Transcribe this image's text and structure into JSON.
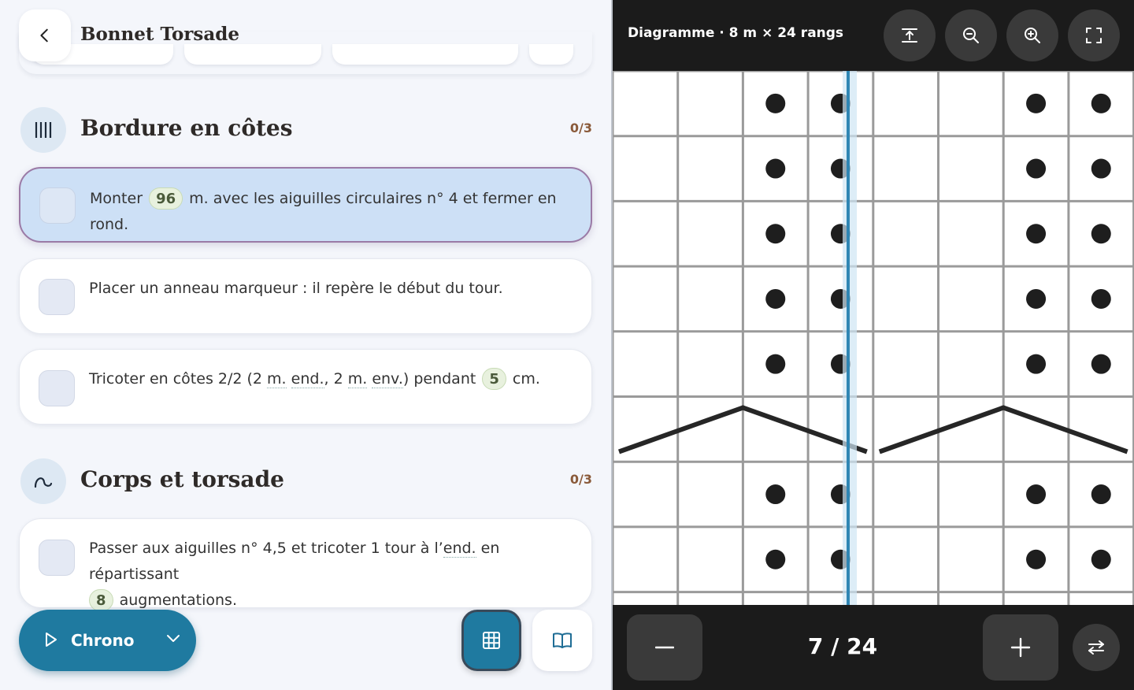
{
  "app": {
    "title": "Bonnet Torsade"
  },
  "sections": [
    {
      "title": "Bordure en côtes",
      "count": "0/3",
      "steps": [
        {
          "parts": [
            "Monter ",
            "96",
            " m. avec les aiguilles circulaires n° 4 et fermer en rond."
          ]
        },
        {
          "parts": [
            "Placer un anneau marqueur : il repère le début du tour."
          ]
        },
        {
          "parts": [
            "Tricoter en côtes 2/2 (2 ",
            "m.",
            " ",
            "end.",
            ", 2 ",
            "m.",
            " ",
            "env.",
            ") pendant ",
            "5",
            " cm."
          ]
        }
      ]
    },
    {
      "title": "Corps et torsade",
      "count": "0/3",
      "steps": [
        {
          "line1": [
            "Passer aux aiguilles n° 4,5 et tricoter 1 tour à l’",
            "end.",
            " en répartissant"
          ],
          "line2": [
            "8",
            " augmentations."
          ]
        }
      ]
    }
  ],
  "bottom": {
    "chrono_label": "Chrono"
  },
  "chart": {
    "title": "Diagramme · 8 m × 24 rangs",
    "row_counter": "7 / 24",
    "visible_rows": [
      {
        "type": "purl-dots",
        "cols": [
          3,
          4,
          7,
          8
        ]
      },
      {
        "type": "purl-dots",
        "cols": [
          3,
          4,
          7,
          8
        ]
      },
      {
        "type": "purl-dots",
        "cols": [
          3,
          4,
          7,
          8
        ]
      },
      {
        "type": "purl-dots",
        "cols": [
          3,
          4,
          7,
          8
        ]
      },
      {
        "type": "purl-dots",
        "cols": [
          3,
          4,
          7,
          8
        ]
      },
      {
        "type": "cable-cross"
      },
      {
        "type": "purl-dots",
        "cols": [
          3,
          4,
          7,
          8
        ]
      },
      {
        "type": "purl-dots",
        "cols": [
          3,
          4,
          7,
          8
        ]
      }
    ]
  },
  "icons": {
    "back": "chevron-left-icon",
    "ribbing": "vertical-bars-icon",
    "cable": "loop-icon",
    "play": "play-icon",
    "chevron": "chevron-down-icon",
    "grid": "grid-icon",
    "book": "book-icon",
    "fit": "fit-height-icon",
    "zoom_out": "zoom-out-icon",
    "zoom_in": "zoom-in-icon",
    "fullscreen": "fullscreen-icon",
    "minus": "minus-icon",
    "plus": "plus-icon",
    "swap": "swap-icon"
  },
  "colors": {
    "accent": "#1f7aa0",
    "active_step": "#cde0f6",
    "count": "#8a5a3a",
    "marker": "#2f86b4"
  }
}
